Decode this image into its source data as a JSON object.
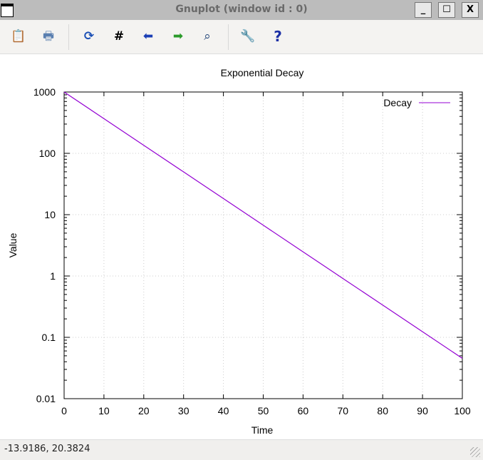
{
  "window": {
    "title": "Gnuplot (window id : 0)",
    "minimize": "_",
    "maximize": "☐",
    "close": "X"
  },
  "toolbar": [
    {
      "name": "copy-to-clipboard-icon",
      "glyph": "📋"
    },
    {
      "name": "print-icon",
      "glyph": "🖶"
    },
    {
      "name": "replot-icon",
      "glyph": "⟳"
    },
    {
      "name": "grid-icon",
      "glyph": "#"
    },
    {
      "name": "zoom-previous-icon",
      "glyph": "⬅"
    },
    {
      "name": "zoom-next-icon",
      "glyph": "➡"
    },
    {
      "name": "autoscale-icon",
      "glyph": "⌕"
    },
    {
      "name": "settings-wrench-icon",
      "glyph": "🔧"
    },
    {
      "name": "help-icon",
      "glyph": "?"
    }
  ],
  "status": {
    "coords": "-13.9186,  20.3824"
  },
  "chart_data": {
    "type": "line",
    "title": "Exponential Decay",
    "xlabel": "Time",
    "ylabel": "Value",
    "xlim": [
      0,
      100
    ],
    "ylim": [
      0.01,
      1000
    ],
    "yscale": "log",
    "xticks": [
      "0",
      "10",
      "20",
      "30",
      "40",
      "50",
      "60",
      "70",
      "80",
      "90",
      "100"
    ],
    "yticks": [
      "0.01",
      "0.1",
      "1",
      "10",
      "100",
      "1000"
    ],
    "grid": true,
    "legend_position": "top-right",
    "series": [
      {
        "name": "Decay",
        "color": "#9400d3",
        "function": "1000*exp(-0.1*x)",
        "x": [
          0,
          10,
          20,
          30,
          40,
          50,
          60,
          70,
          80,
          90,
          100
        ],
        "y": [
          1000,
          367.9,
          135.3,
          49.79,
          18.32,
          6.738,
          2.479,
          0.912,
          0.3355,
          0.1234,
          0.0454
        ]
      }
    ]
  }
}
